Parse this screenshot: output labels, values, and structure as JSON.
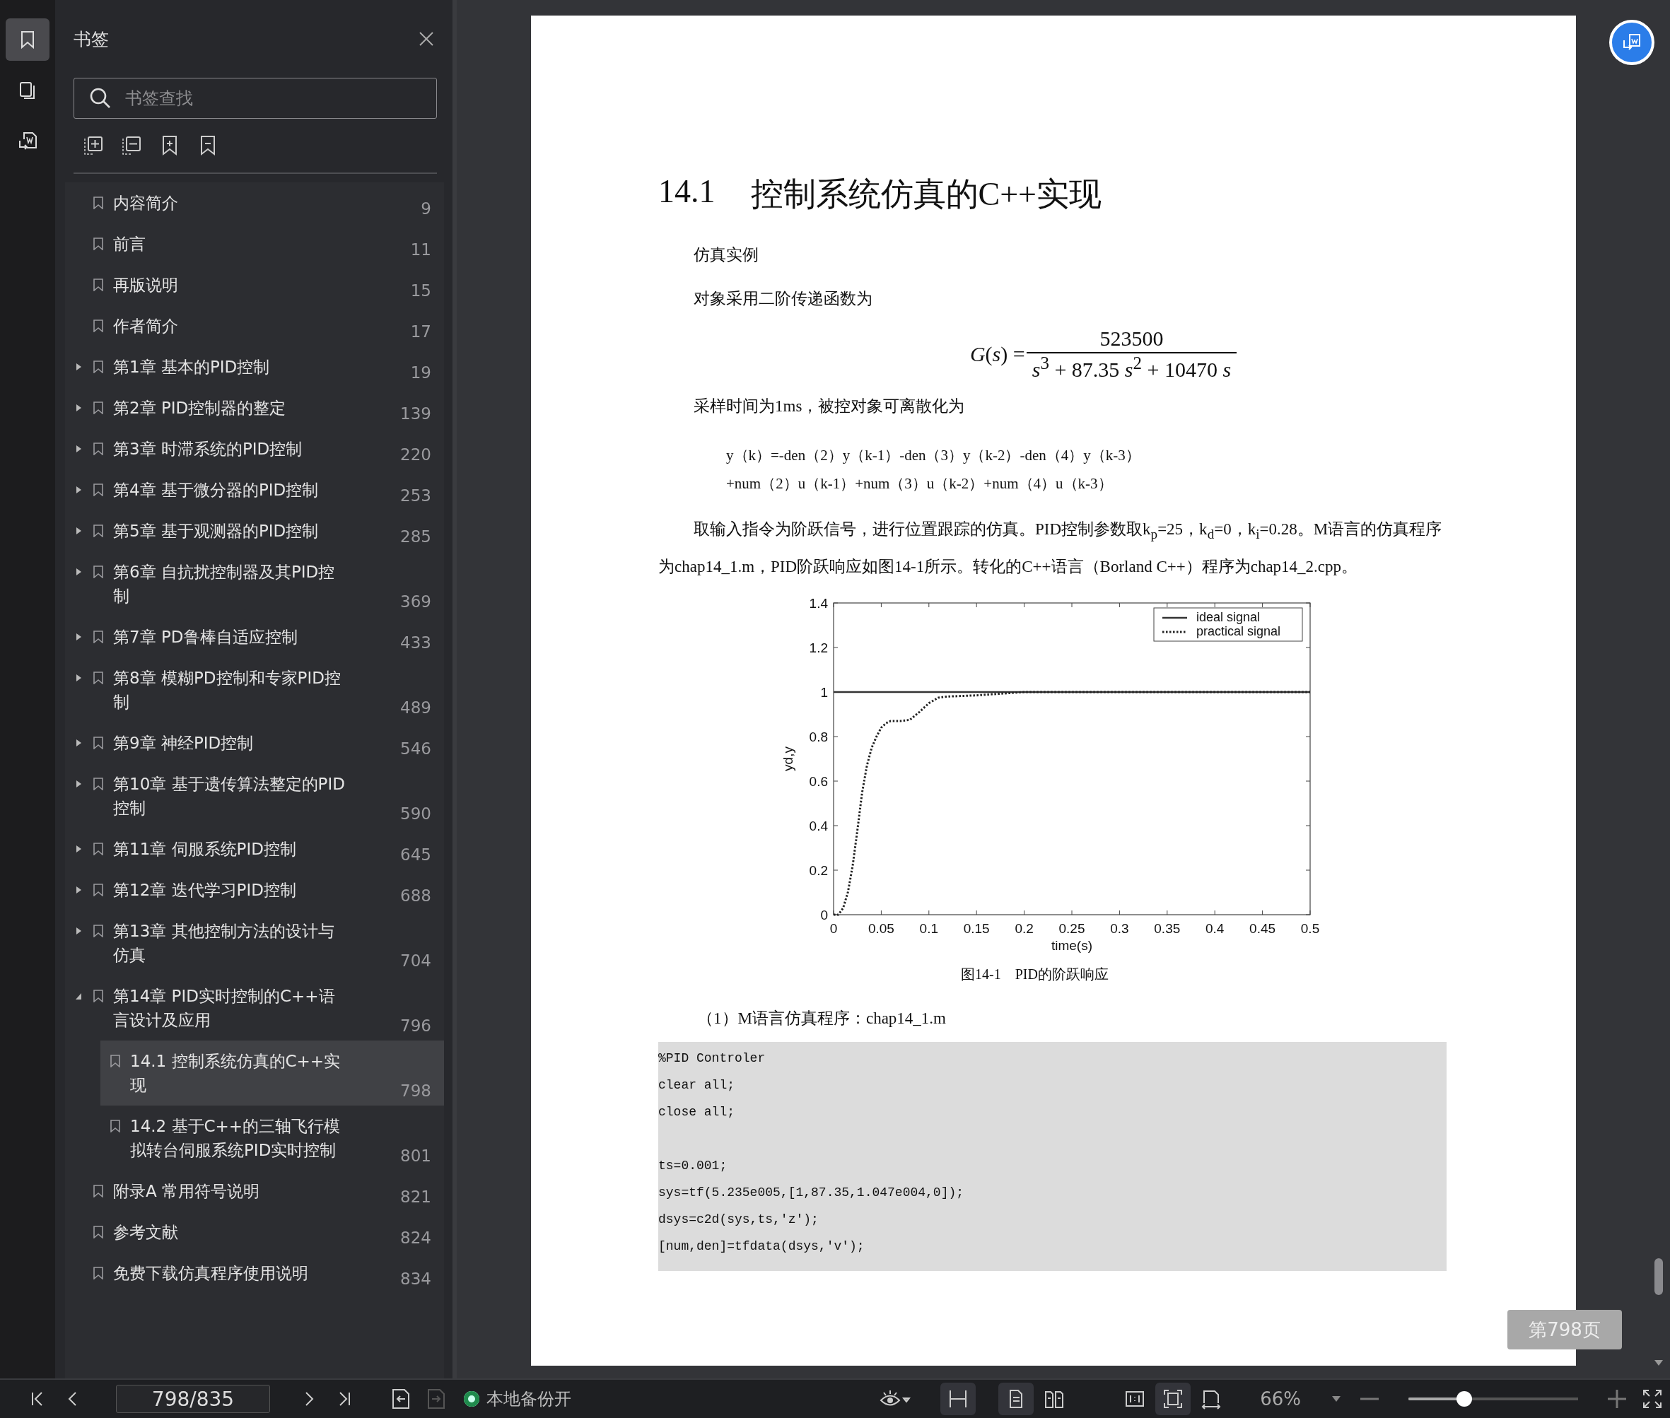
{
  "rail": [
    {
      "kind": "bookmarks",
      "selected": true
    },
    {
      "kind": "pages",
      "selected": false
    },
    {
      "kind": "convert",
      "selected": false
    }
  ],
  "sidebar": {
    "title": "书签",
    "search": {
      "placeholder": "书签查找"
    },
    "items": [
      {
        "label": "内容简介",
        "page": "9",
        "kind": "leaf",
        "selected": false
      },
      {
        "label": "前言",
        "page": "11",
        "kind": "leaf",
        "selected": false
      },
      {
        "label": "再版说明",
        "page": "15",
        "kind": "leaf",
        "selected": false
      },
      {
        "label": "作者简介",
        "page": "17",
        "kind": "leaf",
        "selected": false
      },
      {
        "label": "第1章 基本的PID控制",
        "page": "19",
        "kind": "chapter",
        "expanded": false,
        "selected": false
      },
      {
        "label": "第2章 PID控制器的整定",
        "page": "139",
        "kind": "chapter",
        "expanded": false,
        "selected": false
      },
      {
        "label": "第3章 时滞系统的PID控制",
        "page": "220",
        "kind": "chapter",
        "expanded": false,
        "selected": false
      },
      {
        "label": "第4章 基于微分器的PID控制",
        "page": "253",
        "kind": "chapter",
        "expanded": false,
        "selected": false
      },
      {
        "label": "第5章 基于观测器的PID控制",
        "page": "285",
        "kind": "chapter",
        "expanded": false,
        "selected": false
      },
      {
        "label": "第6章 自抗扰控制器及其PID控制",
        "page": "369",
        "kind": "chapter",
        "expanded": false,
        "selected": false
      },
      {
        "label": "第7章 PD鲁棒自适应控制",
        "page": "433",
        "kind": "chapter",
        "expanded": false,
        "selected": false
      },
      {
        "label": "第8章 模糊PD控制和专家PID控制",
        "page": "489",
        "kind": "chapter",
        "expanded": false,
        "selected": false
      },
      {
        "label": "第9章 神经PID控制",
        "page": "546",
        "kind": "chapter",
        "expanded": false,
        "selected": false
      },
      {
        "label": "第10章 基于遗传算法整定的PID控制",
        "page": "590",
        "kind": "chapter",
        "expanded": false,
        "selected": false
      },
      {
        "label": "第11章 伺服系统PID控制",
        "page": "645",
        "kind": "chapter",
        "expanded": false,
        "selected": false
      },
      {
        "label": "第12章 迭代学习PID控制",
        "page": "688",
        "kind": "chapter",
        "expanded": false,
        "selected": false
      },
      {
        "label": "第13章 其他控制方法的设计与仿真",
        "page": "704",
        "kind": "chapter",
        "expanded": false,
        "selected": false
      },
      {
        "label": "第14章 PID实时控制的C++语言设计及应用",
        "page": "796",
        "kind": "chapter",
        "expanded": true,
        "selected": false,
        "children": [
          {
            "label": "14.1 控制系统仿真的C++实现",
            "page": "798",
            "selected": true
          },
          {
            "label": "14.2 基于C++的三轴飞行模拟转台伺服系统PID实时控制",
            "page": "801",
            "selected": false
          }
        ]
      },
      {
        "label": "附录A 常用符号说明",
        "page": "821",
        "kind": "leaf",
        "selected": false
      },
      {
        "label": "参考文献",
        "page": "824",
        "kind": "leaf",
        "selected": false
      },
      {
        "label": "免费下载仿真程序使用说明",
        "page": "834",
        "kind": "leaf",
        "selected": false
      }
    ]
  },
  "page": {
    "heading_number": "14.1",
    "heading": "控制系统仿真的C++实现",
    "para_1": "仿真实例",
    "para_2": "对象采用二阶传递函数为",
    "formula": {
      "lhs": "*G*(*s*) =",
      "numerator": "523500",
      "denominator": "*s*$^{3}$ + 87.35 *s*$^{2}$ + 10470 *s*"
    },
    "para_3": "采样时间为1ms，被控对象可离散化为",
    "equation_lines": [
      "y（k）=-den（2）y（k-1）-den（3）y（k-2）-den（4）y（k-3）",
      "+num（2）u（k-1）+num（3）u（k-2）+num（4）u（k-3）"
    ],
    "para_4": "取输入指令为阶跃信号，进行位置跟踪的仿真。PID控制参数取k$_{p}$=25，k$_{d}$=0，k$_{i}$=0.28。M语言的仿真程序为chap14_1.m，PID阶跃响应如图14-1所示。转化的C++语言（Borland C++）程序为chap14_2.cpp。",
    "chart_data": {
      "type": "line",
      "xlabel": "time(s)",
      "ylabel": "yd,y",
      "x": [
        0,
        0.005,
        0.01,
        0.015,
        0.02,
        0.025,
        0.03,
        0.035,
        0.04,
        0.045,
        0.05,
        0.055,
        0.06,
        0.065,
        0.07,
        0.08,
        0.09,
        0.1,
        0.11,
        0.12,
        0.15,
        0.2,
        0.25,
        0.3,
        0.4,
        0.5
      ],
      "legend": true,
      "series": [
        {
          "name": "ideal signal",
          "color": "#333333",
          "line_style": "solid",
          "values": [
            1,
            1,
            1,
            1,
            1,
            1,
            1,
            1,
            1,
            1,
            1,
            1,
            1,
            1,
            1,
            1,
            1,
            1,
            1,
            1,
            1,
            1,
            1,
            1,
            1,
            1
          ]
        },
        {
          "name": "practical signal",
          "color": "#222222",
          "line_style": "dotted",
          "values": [
            0,
            0,
            0.03,
            0.1,
            0.22,
            0.38,
            0.55,
            0.67,
            0.75,
            0.8,
            0.84,
            0.86,
            0.87,
            0.87,
            0.87,
            0.875,
            0.91,
            0.95,
            0.975,
            0.98,
            0.985,
            1,
            1,
            1,
            1,
            1
          ]
        }
      ],
      "xlim": [
        0,
        0.5
      ],
      "ylim": [
        0,
        1.4
      ],
      "xticks": [
        0,
        0.05,
        0.1,
        0.15,
        0.2,
        0.25,
        0.3,
        0.35,
        0.4,
        0.45,
        0.5
      ],
      "yticks": [
        0,
        0.2,
        0.4,
        0.6,
        0.8,
        1,
        1.2,
        1.4
      ]
    },
    "caption": "图14-1　PID的阶跃响应",
    "program_title": "（1）M语言仿真程序：chap14_1.m",
    "code_groups": [
      [
        "%PID Controler",
        "clear all;",
        "close all;"
      ],
      [
        "ts=0.001;",
        "sys=tf(5.235e005,[1,87.35,1.047e004,0]);",
        "dsys=c2d(sys,ts,'z');",
        "[num,den]=tfdata(dsys,'v');"
      ]
    ]
  },
  "page_badge": "第798页",
  "toolbar": {
    "page_field": {
      "value": "798/835"
    },
    "doc_back": {
      "disabled": false
    },
    "doc_forward": {
      "disabled": true
    },
    "backup": {
      "label": "本地备份开",
      "on": true
    },
    "view_tools": [
      {
        "kind": "fit-width",
        "selected": true
      },
      {
        "kind": "single-page",
        "selected": true
      },
      {
        "kind": "two-page",
        "selected": false
      },
      {
        "kind": "actual-size",
        "selected": false
      },
      {
        "kind": "fit-page",
        "selected": true
      },
      {
        "kind": "rotate",
        "selected": false
      }
    ],
    "zoom": {
      "label": "66%",
      "level": 0.33
    }
  }
}
